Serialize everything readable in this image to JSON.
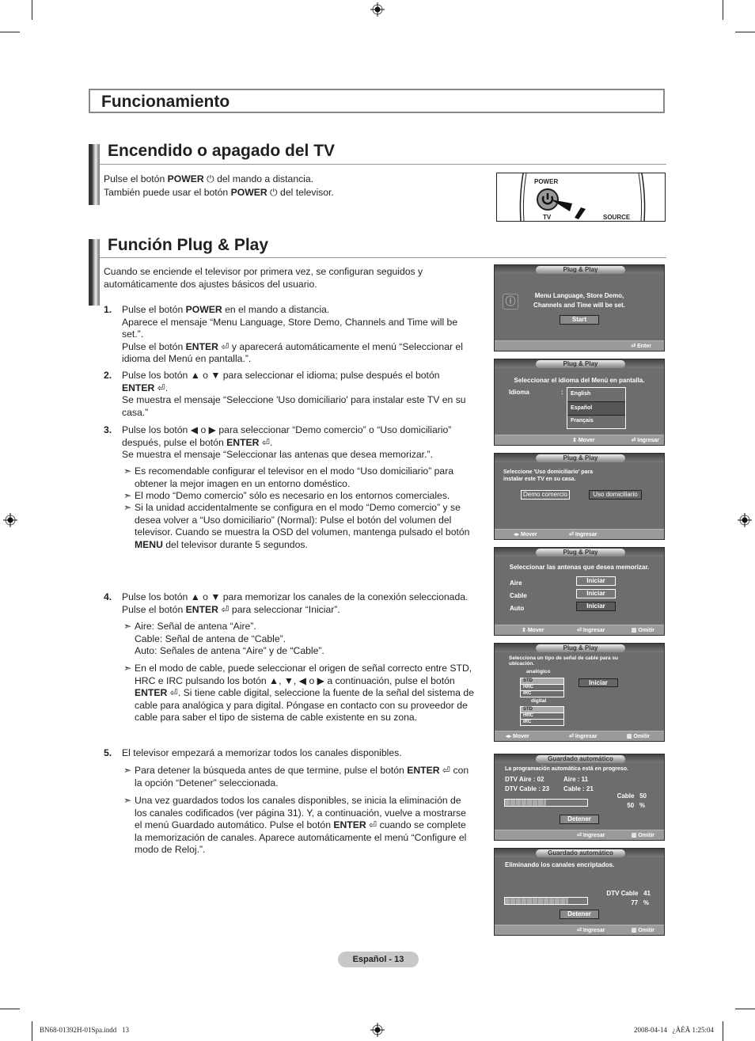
{
  "header": {
    "title": "Funcionamiento"
  },
  "section1": {
    "title": "Encendido o apagado del TV",
    "line1_a": "Pulse el botón ",
    "line1_b": "POWER",
    "line1_c": " del mando a distancia.",
    "line2_a": "También puede usar el botón ",
    "line2_b": "POWER",
    "line2_c": " del televisor.",
    "remote": {
      "power_label": "POWER",
      "tv_label": "TV",
      "source_label": "SOURCE"
    }
  },
  "section2": {
    "title": "Función Plug & Play",
    "intro_1": "Cuando se enciende el televisor por primera vez, se configuran seguidos y",
    "intro_2": "automáticamente dos ajustes básicos del usuario.",
    "steps": [
      {
        "num": "1.",
        "lines": [
          "Pulse el botón POWER en el mando a distancia.",
          "Aparece el mensaje “Menu Language, Store Demo, Channels and Time will be",
          "set.”.",
          "Pulse el botón ENTER ⏎ y aparecerá automáticamente el menú “Seleccionar el",
          "idioma del Menú en pantalla.”."
        ]
      },
      {
        "num": "2.",
        "lines": [
          "Pulse los botón ▲ o ▼ para seleccionar el idioma; pulse después el botón",
          "ENTER ⏎.",
          "Se muestra el mensaje “Seleccione 'Uso domiciliario' para instalar este TV en su",
          "casa.”"
        ]
      },
      {
        "num": "3.",
        "lines": [
          "Pulse los botón ◀ o ▶ para seleccionar “Demo comercio” o “Uso domiciliario”",
          "después, pulse el botón ENTER ⏎.",
          "Se muestra el mensaje “Seleccionar las antenas que desea memorizar.”."
        ],
        "notes": [
          [
            "Es recomendable configurar el televisor en el modo “Uso domiciliario” para",
            "obtener la mejor imagen en un entorno doméstico."
          ],
          [
            "El modo “Demo comercio” sólo es necesario en los entornos comerciales."
          ],
          [
            "Si la unidad accidentalmente se configura en el modo “Demo comercio” y se",
            "desea volver a “Uso domiciliario” (Normal): Pulse el botón del volumen del",
            "televisor. Cuando se muestra la OSD del volumen, mantenga pulsado el botón",
            "MENU del televisor durante 5 segundos."
          ]
        ]
      },
      {
        "num": "4.",
        "lines": [
          "Pulse los botón ▲ o ▼ para memorizar los canales de la conexión seleccionada.",
          "Pulse el botón ENTER ⏎ para seleccionar “Iniciar”."
        ],
        "notes": [
          [
            "Aire: Señal de antena “Aire”.",
            "Cable: Señal de antena de “Cable”.",
            "Auto: Señales de antena “Aire” y de “Cable”."
          ],
          [
            "En el modo de cable, puede seleccionar el origen de señal correcto entre STD,",
            "HRC e IRC pulsando los botón ▲, ▼, ◀ o ▶ a continuación, pulse el botón",
            "ENTER ⏎. Si tiene cable digital, seleccione la fuente de la señal del sistema de",
            "cable para analógica y para digital. Póngase en contacto con su proveedor de",
            "cable para saber el tipo de sistema de cable existente en su zona."
          ]
        ]
      },
      {
        "num": "5.",
        "lines": [
          "El televisor empezará a memorizar todos los canales disponibles."
        ],
        "notes": [
          [
            "Para detener la búsqueda antes de que termine, pulse el botón ENTER ⏎ con",
            "la opción “Detener” seleccionada."
          ],
          [
            "Una vez guardados todos los canales disponibles, se inicia la eliminación de",
            "los canales codificados (ver página 31). Y, a continuación, vuelve a mostrarse",
            "el menú Guardado automático. Pulse el botón ENTER ⏎ cuando se complete",
            "la memorización de canales. Aparece automáticamente el menú “Configure el",
            "modo de Reloj.”."
          ]
        ]
      }
    ]
  },
  "osd": {
    "s1": {
      "title": "Plug & Play",
      "msg1": "Menu Language, Store Demo,",
      "msg2": "Channels and Time will be set.",
      "start": "Start",
      "enter": "Enter",
      "icon": "info-icon"
    },
    "s2": {
      "title": "Plug & Play",
      "msg": "Seleccionar el idioma del Menú en pantalla.",
      "label": "Idioma",
      "colon": ":",
      "options": [
        "English",
        "Español",
        "Français"
      ],
      "selected": "Español",
      "move": "Mover",
      "enter": "Ingresar"
    },
    "s3": {
      "title": "Plug & Play",
      "msg1": "Seleccione 'Uso domiciliario' para",
      "msg2": "instalar este TV en su casa.",
      "opt1": "Demo comercio",
      "opt2": "Uso domiciliario",
      "selected": "Uso domiciliario",
      "move": "Mover",
      "enter": "Ingresar"
    },
    "s4": {
      "title": "Plug & Play",
      "msg": "Seleccionar las antenas que desea memorizar.",
      "rows": [
        {
          "label": "Aire",
          "btn": "Iniciar"
        },
        {
          "label": "Cable",
          "btn": "Iniciar"
        },
        {
          "label": "Auto",
          "btn": "Iniciar"
        }
      ],
      "selected": "Auto",
      "move": "Mover",
      "enter": "Ingresar",
      "skip": "Omitir"
    },
    "s5": {
      "title": "Plug & Play",
      "msg1": "Selecciona un tipo de señal de cable para su",
      "msg2": "ubicación.",
      "analog": "analógico",
      "digital": "digital",
      "types": [
        "STD",
        "HRC",
        "IRC"
      ],
      "btn": "Iniciar",
      "move": "Mover",
      "enter": "Ingresar",
      "skip": "Omitir"
    },
    "s6": {
      "title": "Guardado automático",
      "msg": "La programación automática está en progreso.",
      "dtv_air": "DTV Aire : 02",
      "air": "Aire : 11",
      "dtv_cable": "DTV Cable : 23",
      "cable": "Cable : 21",
      "right1": "Cable   50",
      "right2": "50   %",
      "progress": 50,
      "btn": "Detener",
      "enter": "Ingresar",
      "skip": "Omitir"
    },
    "s7": {
      "title": "Guardado automático",
      "msg": "Eliminando los canales encriptados.",
      "right1": "DTV Cable   41",
      "right2": "77   %",
      "progress": 77,
      "btn": "Detener",
      "enter": "Ingresar",
      "skip": "Omitir"
    }
  },
  "footer": {
    "page": "Español - 13",
    "file": "BN68-01392H-01Spa.indd   13",
    "stamp": "2008-04-14   ¿ÀÈÄ 1:25:04"
  }
}
